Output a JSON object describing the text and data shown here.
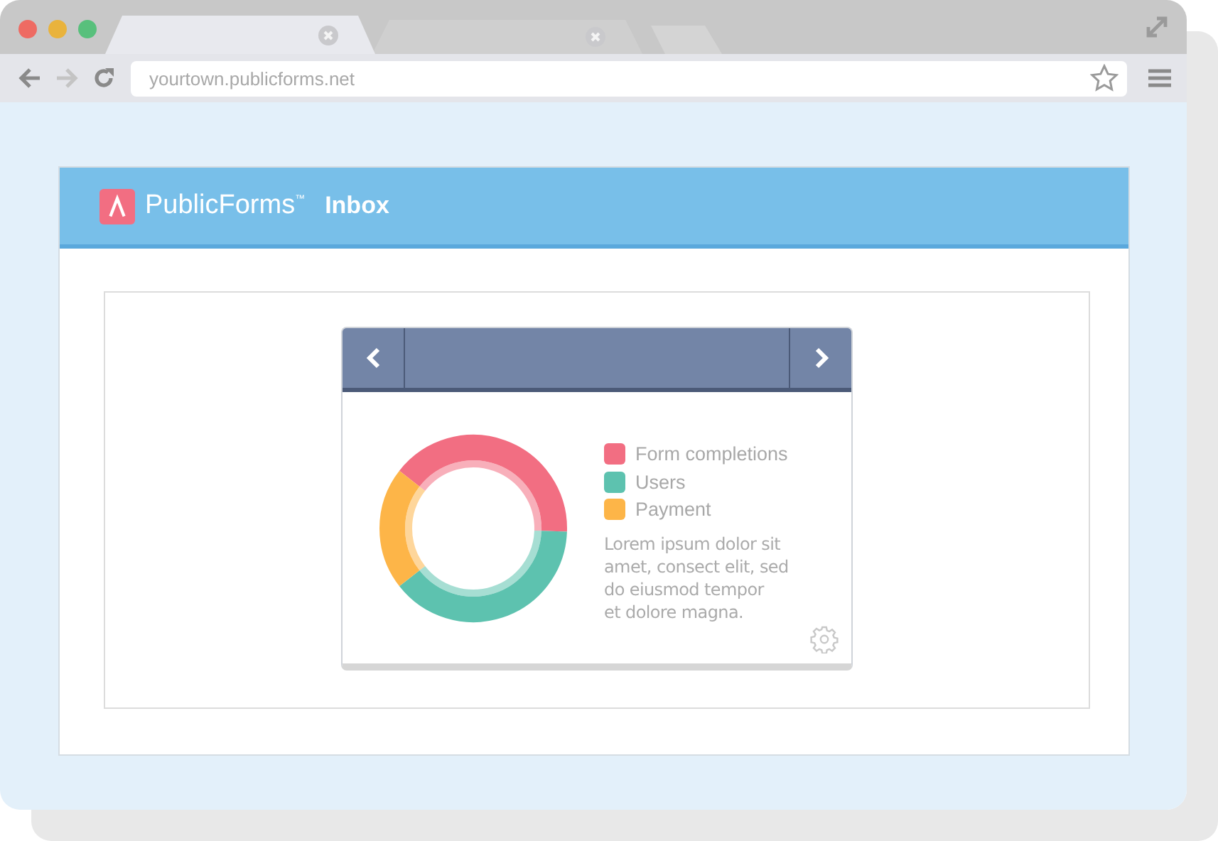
{
  "browser": {
    "tabs": [
      {
        "selected": true
      },
      {
        "selected": false
      }
    ],
    "url": "yourtown.publicforms.net"
  },
  "app": {
    "brand": "PublicForms",
    "trademark": "™",
    "title": "Inbox"
  },
  "widget": {
    "legend": [
      {
        "label": "Form completions",
        "color": "#f26e82"
      },
      {
        "label": "Users",
        "color": "#5dc2af"
      },
      {
        "label": "Payment",
        "color": "#fdb548"
      }
    ],
    "description": [
      "Lorem ipsum dolor sit",
      "amet, consect elit, sed",
      "do eiusmod tempor",
      "et dolore magna."
    ]
  }
}
